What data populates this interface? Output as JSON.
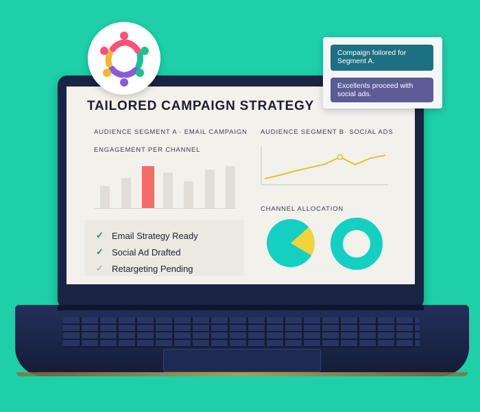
{
  "dashboard": {
    "title": "TAILORED CAMPAIGN STRATEGY",
    "segment_a_label": "AUDIENCE SEGMENT A · EMAIL CAMPAIGN",
    "segment_b_label": "AUDIENCE SEGMENT B· SOCIAL ADS",
    "engagement_label": "ENGAGEMENT PER CHANNEL",
    "allocation_label": "CHANNEL ALLOCATION",
    "checklist": [
      {
        "label": "Email  Strategy Ready",
        "done": true
      },
      {
        "label": "Social Ad Drafted",
        "done": true
      },
      {
        "label": "Retargeting  Pending",
        "done": false
      }
    ]
  },
  "chat": {
    "messages": [
      {
        "text": "Compaign foilored for Segment A."
      },
      {
        "text": "Excellents proceed with social ads."
      }
    ]
  },
  "colors": {
    "background": "#1ecfa9",
    "highlight_bar": "#f26b66",
    "line": "#e6bf2e",
    "pie_main": "#14cfc2",
    "pie_slice": "#f0d43a",
    "chat_bubble_1": "#1d6f82",
    "chat_bubble_2": "#5b5b96"
  },
  "icons": {
    "logo": "people-circle-icon",
    "check": "check-icon"
  },
  "chart_data": [
    {
      "type": "bar",
      "title": "ENGAGEMENT PER CHANNEL",
      "categories": [
        "",
        "",
        "",
        "",
        "",
        "",
        ""
      ],
      "values": [
        33,
        45,
        62,
        53,
        40,
        57,
        62
      ],
      "highlight_index": 2,
      "ylim": [
        0,
        70
      ]
    },
    {
      "type": "line",
      "title": "AUDIENCE SEGMENT B· SOCIAL ADS",
      "x": [
        1,
        2,
        3,
        4,
        5,
        6,
        7,
        8,
        9
      ],
      "y": [
        8,
        14,
        21,
        27,
        33,
        45,
        32,
        43,
        48
      ],
      "marker_index": 5,
      "ylim": [
        0,
        60
      ]
    },
    {
      "type": "pie",
      "title": "CHANNEL ALLOCATION",
      "values": [
        80,
        20
      ]
    },
    {
      "type": "pie",
      "donut": true,
      "values": [
        100
      ]
    }
  ]
}
